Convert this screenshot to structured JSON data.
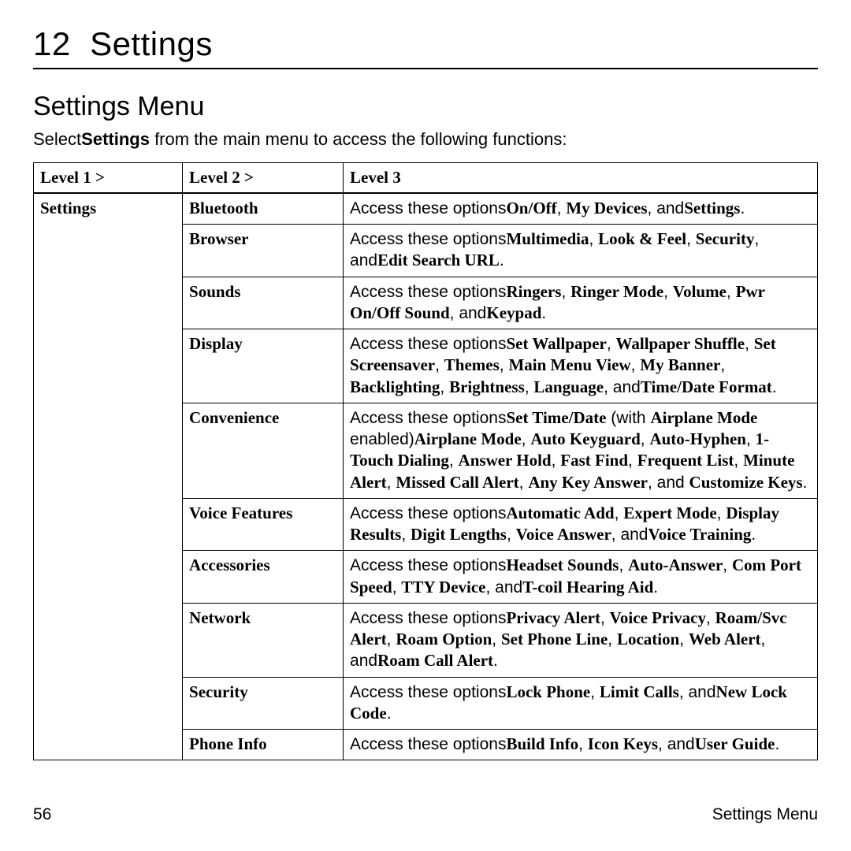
{
  "chapter": {
    "number": "12",
    "title": "Settings"
  },
  "section_title": "Settings Menu",
  "intro": {
    "prefix": "Select",
    "bold": "Settings",
    "suffix": " from the main menu to access the following functions:"
  },
  "headers": {
    "c1": "Level 1 >",
    "c2": "Level 2 >",
    "c3": "Level 3"
  },
  "level1": "Settings",
  "rows": [
    {
      "level2": "Bluetooth",
      "level3": [
        {
          "t": "Access these options"
        },
        {
          "b": "On/Off"
        },
        {
          "t": ", "
        },
        {
          "b": "My Devices"
        },
        {
          "t": ", and"
        },
        {
          "b": "Settings"
        },
        {
          "t": "."
        }
      ]
    },
    {
      "level2": "Browser",
      "level3": [
        {
          "t": "Access these options"
        },
        {
          "b": "Multimedia"
        },
        {
          "t": ", "
        },
        {
          "b": "Look & Feel"
        },
        {
          "t": ", "
        },
        {
          "b": "Security"
        },
        {
          "t": ", and"
        },
        {
          "b": "Edit Search URL"
        },
        {
          "t": "."
        }
      ]
    },
    {
      "level2": "Sounds",
      "level3": [
        {
          "t": "Access these options"
        },
        {
          "b": "Ringers"
        },
        {
          "t": ", "
        },
        {
          "b": "Ringer Mode"
        },
        {
          "t": ", "
        },
        {
          "b": "Volume"
        },
        {
          "t": ", "
        },
        {
          "b": "Pwr On/Off Sound"
        },
        {
          "t": ", and"
        },
        {
          "b": "Keypad"
        },
        {
          "t": "."
        }
      ]
    },
    {
      "level2": "Display",
      "level3": [
        {
          "t": "Access these options"
        },
        {
          "b": "Set Wallpaper"
        },
        {
          "t": ", "
        },
        {
          "b": "Wallpaper Shuffle"
        },
        {
          "t": ", "
        },
        {
          "b": "Set Screensaver"
        },
        {
          "t": ", "
        },
        {
          "b": "Themes"
        },
        {
          "t": ", "
        },
        {
          "b": "Main Menu View"
        },
        {
          "t": ", "
        },
        {
          "b": "My Banner"
        },
        {
          "t": ", "
        },
        {
          "b": "Backlighting"
        },
        {
          "t": ", "
        },
        {
          "b": "Brightness"
        },
        {
          "t": ", "
        },
        {
          "b": "Language"
        },
        {
          "t": ", and"
        },
        {
          "b": "Time/Date Format"
        },
        {
          "t": "."
        }
      ]
    },
    {
      "level2": "Convenience",
      "level3": [
        {
          "t": "Access these options"
        },
        {
          "b": "Set Time/Date"
        },
        {
          "t": " (with "
        },
        {
          "b": "Airplane Mode"
        },
        {
          "t": " enabled)"
        },
        {
          "b": "Airplane Mode"
        },
        {
          "t": ", "
        },
        {
          "b": "Auto Keyguard"
        },
        {
          "t": ", "
        },
        {
          "b": "Auto-Hyphen"
        },
        {
          "t": ", "
        },
        {
          "b": "1-Touch Dialing"
        },
        {
          "t": ", "
        },
        {
          "b": "Answer Hold"
        },
        {
          "t": ", "
        },
        {
          "b": "Fast Find"
        },
        {
          "t": ", "
        },
        {
          "b": "Frequent List"
        },
        {
          "t": ", "
        },
        {
          "b": "Minute Alert"
        },
        {
          "t": ", "
        },
        {
          "b": "Missed Call Alert"
        },
        {
          "t": ", "
        },
        {
          "b": "Any Key Answer"
        },
        {
          "t": ", and "
        },
        {
          "b": "Customize Keys"
        },
        {
          "t": "."
        }
      ]
    },
    {
      "level2": "Voice Features",
      "level3": [
        {
          "t": "Access these options"
        },
        {
          "b": "Automatic Add"
        },
        {
          "t": ", "
        },
        {
          "b": "Expert Mode"
        },
        {
          "t": ", "
        },
        {
          "b": "Display Results"
        },
        {
          "t": ", "
        },
        {
          "b": "Digit Lengths"
        },
        {
          "t": ", "
        },
        {
          "b": "Voice Answer"
        },
        {
          "t": ", and"
        },
        {
          "b": "Voice Training"
        },
        {
          "t": "."
        }
      ]
    },
    {
      "level2": "Accessories",
      "level3": [
        {
          "t": "Access these options"
        },
        {
          "b": "Headset Sounds"
        },
        {
          "t": ", "
        },
        {
          "b": "Auto-Answer"
        },
        {
          "t": ", "
        },
        {
          "b": "Com Port Speed"
        },
        {
          "t": ", "
        },
        {
          "b": "TTY Device"
        },
        {
          "t": ", and"
        },
        {
          "b": "T-coil Hearing Aid"
        },
        {
          "t": "."
        }
      ]
    },
    {
      "level2": "Network",
      "level3": [
        {
          "t": "Access these options"
        },
        {
          "b": "Privacy Alert"
        },
        {
          "t": ", "
        },
        {
          "b": "Voice Privacy"
        },
        {
          "t": ", "
        },
        {
          "b": "Roam/Svc Alert"
        },
        {
          "t": ", "
        },
        {
          "b": "Roam Option"
        },
        {
          "t": ", "
        },
        {
          "b": "Set Phone Line"
        },
        {
          "t": ", "
        },
        {
          "b": "Location"
        },
        {
          "t": ", "
        },
        {
          "b": "Web Alert"
        },
        {
          "t": ", and"
        },
        {
          "b": "Roam Call Alert"
        },
        {
          "t": "."
        }
      ]
    },
    {
      "level2": "Security",
      "level3": [
        {
          "t": "Access these options"
        },
        {
          "b": "Lock Phone"
        },
        {
          "t": ", "
        },
        {
          "b": "Limit Calls"
        },
        {
          "t": ", and"
        },
        {
          "b": "New Lock Code"
        },
        {
          "t": "."
        }
      ]
    },
    {
      "level2": "Phone Info",
      "level3": [
        {
          "t": "Access these options"
        },
        {
          "b": "Build Info"
        },
        {
          "t": ", "
        },
        {
          "b": "Icon Keys"
        },
        {
          "t": ", and"
        },
        {
          "b": "User Guide"
        },
        {
          "t": "."
        }
      ]
    }
  ],
  "footer": {
    "page": "56",
    "label": "Settings Menu"
  }
}
